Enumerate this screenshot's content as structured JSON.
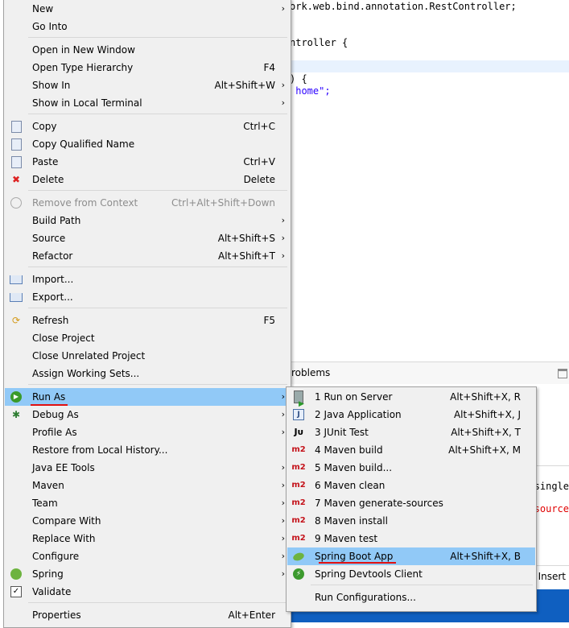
{
  "editor": {
    "lines": [
      "ork.web.bind.annotation.RestController;",
      "ntroller {",
      ") {",
      " home\";"
    ],
    "string_fragment": "home\""
  },
  "lower_pane": {
    "problems_tab": "roblems",
    "text1": "rsingle",
    "text2": "source",
    "status_insert": "Insert"
  },
  "main_menu": {
    "items": [
      {
        "label": "New",
        "shortcut": "",
        "submenu": true
      },
      {
        "label": "Go Into",
        "shortcut": "",
        "submenu": false
      },
      {
        "label": "Open in New Window",
        "shortcut": "",
        "submenu": false
      },
      {
        "label": "Open Type Hierarchy",
        "shortcut": "F4",
        "submenu": false
      },
      {
        "label": "Show In",
        "shortcut": "Alt+Shift+W",
        "submenu": true
      },
      {
        "label": "Show in Local Terminal",
        "shortcut": "",
        "submenu": true
      },
      {
        "label": "Copy",
        "shortcut": "Ctrl+C",
        "submenu": false
      },
      {
        "label": "Copy Qualified Name",
        "shortcut": "",
        "submenu": false
      },
      {
        "label": "Paste",
        "shortcut": "Ctrl+V",
        "submenu": false
      },
      {
        "label": "Delete",
        "shortcut": "Delete",
        "submenu": false
      },
      {
        "label": "Remove from Context",
        "shortcut": "Ctrl+Alt+Shift+Down",
        "submenu": false
      },
      {
        "label": "Build Path",
        "shortcut": "",
        "submenu": true
      },
      {
        "label": "Source",
        "shortcut": "Alt+Shift+S",
        "submenu": true
      },
      {
        "label": "Refactor",
        "shortcut": "Alt+Shift+T",
        "submenu": true
      },
      {
        "label": "Import...",
        "shortcut": "",
        "submenu": false
      },
      {
        "label": "Export...",
        "shortcut": "",
        "submenu": false
      },
      {
        "label": "Refresh",
        "shortcut": "F5",
        "submenu": false
      },
      {
        "label": "Close Project",
        "shortcut": "",
        "submenu": false
      },
      {
        "label": "Close Unrelated Project",
        "shortcut": "",
        "submenu": false
      },
      {
        "label": "Assign Working Sets...",
        "shortcut": "",
        "submenu": false
      },
      {
        "label": "Run As",
        "shortcut": "",
        "submenu": true
      },
      {
        "label": "Debug As",
        "shortcut": "",
        "submenu": true
      },
      {
        "label": "Profile As",
        "shortcut": "",
        "submenu": true
      },
      {
        "label": "Restore from Local History...",
        "shortcut": "",
        "submenu": false
      },
      {
        "label": "Java EE Tools",
        "shortcut": "",
        "submenu": true
      },
      {
        "label": "Maven",
        "shortcut": "",
        "submenu": true
      },
      {
        "label": "Team",
        "shortcut": "",
        "submenu": true
      },
      {
        "label": "Compare With",
        "shortcut": "",
        "submenu": true
      },
      {
        "label": "Replace With",
        "shortcut": "",
        "submenu": true
      },
      {
        "label": "Configure",
        "shortcut": "",
        "submenu": true
      },
      {
        "label": "Spring",
        "shortcut": "",
        "submenu": true
      },
      {
        "label": "Validate",
        "shortcut": "",
        "submenu": false
      },
      {
        "label": "Properties",
        "shortcut": "Alt+Enter",
        "submenu": false
      }
    ],
    "arrow": "›"
  },
  "run_as_menu": {
    "items": [
      {
        "label": "1 Run on Server",
        "shortcut": "Alt+Shift+X, R",
        "icon": "server-run-icon"
      },
      {
        "label": "2 Java Application",
        "shortcut": "Alt+Shift+X, J",
        "icon": "java-app-icon"
      },
      {
        "label": "3 JUnit Test",
        "shortcut": "Alt+Shift+X, T",
        "icon": "junit-icon"
      },
      {
        "label": "4 Maven build",
        "shortcut": "Alt+Shift+X, M",
        "icon": "maven-icon"
      },
      {
        "label": "5 Maven build...",
        "shortcut": "",
        "icon": "maven-icon"
      },
      {
        "label": "6 Maven clean",
        "shortcut": "",
        "icon": "maven-icon"
      },
      {
        "label": "7 Maven generate-sources",
        "shortcut": "",
        "icon": "maven-icon"
      },
      {
        "label": "8 Maven install",
        "shortcut": "",
        "icon": "maven-icon"
      },
      {
        "label": "9 Maven test",
        "shortcut": "",
        "icon": "maven-icon"
      },
      {
        "label": "Spring Boot App",
        "shortcut": "Alt+Shift+X, B",
        "icon": "spring-boot-icon"
      },
      {
        "label": "Spring Devtools Client",
        "shortcut": "",
        "icon": "spring-devtools-icon"
      },
      {
        "label": "Run Configurations...",
        "shortcut": "",
        "icon": ""
      }
    ],
    "maven_icon_text": "m2",
    "junit_icon_text": "Jᴜ",
    "java_icon_text": "J"
  },
  "colors": {
    "menu_bg": "#f0f0f0",
    "selection": "#91c9f7",
    "annotation_underline": "#e01010",
    "maven_red": "#c4121a"
  }
}
